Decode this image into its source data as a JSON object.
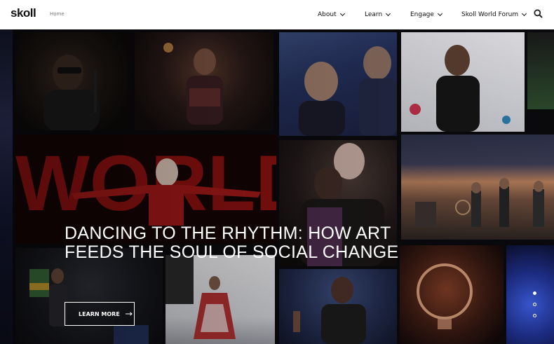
{
  "header": {
    "logo": "skoll",
    "breadcrumb": "Home",
    "nav": [
      {
        "label": "About"
      },
      {
        "label": "Learn"
      },
      {
        "label": "Engage"
      },
      {
        "label": "Skoll World Forum"
      }
    ],
    "search_icon": "search-icon"
  },
  "hero": {
    "headline": "DANCING TO THE RHYTHM: HOW ART FEEDS THE SOUL OF SOCIAL CHANGE",
    "cta_label": "LEARN MORE",
    "background_word": "WORLD",
    "slides": 3,
    "active_slide": 1
  },
  "colors": {
    "header_bg": "#ffffff",
    "text_dark": "#111111",
    "hero_text": "#ffffff",
    "stage_red": "#8a1010"
  }
}
